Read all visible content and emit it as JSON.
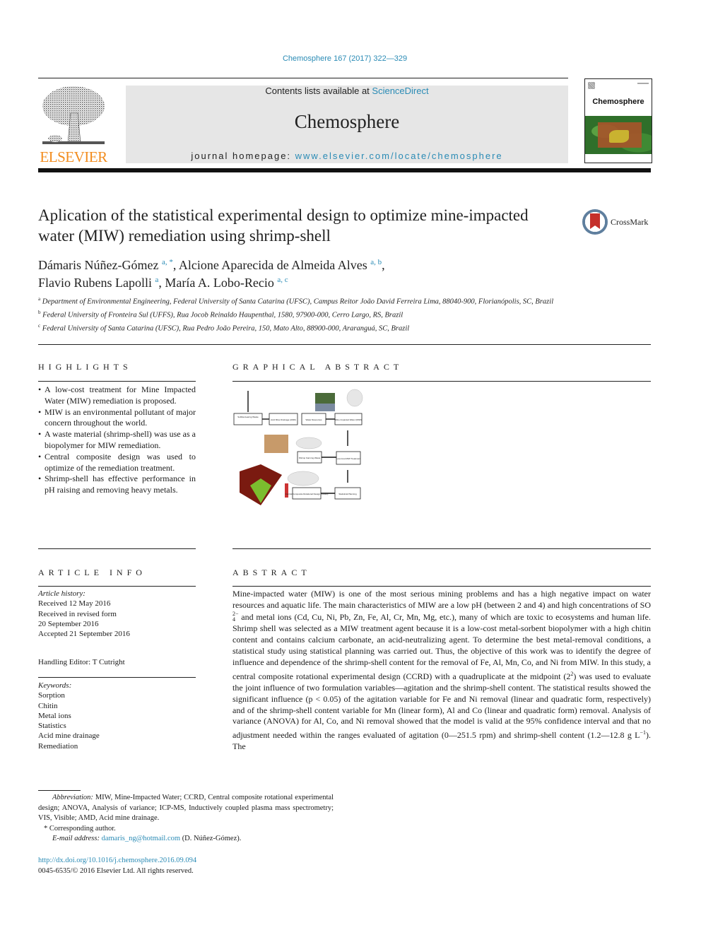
{
  "header": {
    "citation": "Chemosphere 167 (2017) 322—329",
    "contents_prefix": "Contents lists available at ",
    "contents_link": "ScienceDirect",
    "journal_name": "Chemosphere",
    "homepage_prefix": "journal homepage: ",
    "homepage_link": "www.elsevier.com/locate/chemosphere",
    "publisher_wordmark": "ELSEVIER",
    "cover_title": "Chemosphere",
    "crossmark_label": "CrossMark"
  },
  "article": {
    "title": "Aplication of the statistical experimental design to optimize mine-impacted water (MIW) remediation using shrimp-shell",
    "authors": [
      {
        "name": "Dámaris Núñez-Gómez",
        "sup": "a, *",
        "sep": ", "
      },
      {
        "name": "Alcione Aparecida de Almeida Alves",
        "sup": "a, b",
        "sep": ","
      },
      {
        "name": "Flavio Rubens Lapolli",
        "sup": "a",
        "sep": ", "
      },
      {
        "name": "María A. Lobo-Recio",
        "sup": "a, c",
        "sep": ""
      }
    ],
    "affiliations": [
      {
        "mark": "a",
        "text": "Department of Environmental Engineering, Federal University of Santa Catarina (UFSC), Campus Reitor João David Ferreira Lima, 88040-900, Florianópolis, SC, Brazil"
      },
      {
        "mark": "b",
        "text": "Federal University of Fronteira Sul (UFFS), Rua Jocob Reinaldo Haupenthal, 1580, 97900-000, Cerro Largo, RS, Brazil"
      },
      {
        "mark": "c",
        "text": "Federal University of Santa Catarina (UFSC), Rua Pedro João Pereira, 150, Mato Alto, 88900-000, Araranguá, SC, Brazil"
      }
    ]
  },
  "highlights": {
    "heading": "HIGHLIGHTS",
    "items": [
      "A low-cost treatment for Mine Impacted Water (MIW) remediation is proposed.",
      "MIW is an environmental pollutant of major concern throughout the world.",
      "A waste material (shrimp-shell) was use as a biopolymer for MIW remediation.",
      "Central composite design was used to optimize of the remediation treatment.",
      "Shrimp-shell has effective performance in pH raising and removing heavy metals."
    ]
  },
  "graphical_abstract": {
    "heading": "GRAPHICAL ABSTRACT",
    "boxes": {
      "sulfide_waste": "Sulfide-bearing Waste",
      "amd": "Acid Mine Drainage (AMD)",
      "water_resources": "Water Resources",
      "miw": "Mine Impacted Water (MIW)",
      "shrimp_waste": "Shrimp Farming Waste",
      "treatment": "Low-Cost MIW Treatment",
      "statistical": "Statistical Planning",
      "ccrd": "Central Composite Rotational Design (CCRD)"
    }
  },
  "article_info": {
    "heading": "ARTICLE INFO",
    "history_label": "Article history:",
    "history": [
      "Received 12 May 2016",
      "Received in revised form",
      "20 September 2016",
      "Accepted 21 September 2016"
    ],
    "handling_editor": "Handling Editor: T Cutright",
    "keywords_label": "Keywords:",
    "keywords": [
      "Sorption",
      "Chitin",
      "Metal ions",
      "Statistics",
      "Acid mine drainage",
      "Remediation"
    ]
  },
  "abstract": {
    "heading": "ABSTRACT",
    "p1": "Mine-impacted water (MIW) is one of the most serious mining problems and has a high negative impact on water resources and aquatic life. The main characteristics of MIW are a low pH (between 2 and 4) and high concentrations of SO",
    "so4_sup": "2−",
    "so4_sub": "4",
    "p2": " and metal ions (Cd, Cu, Ni, Pb, Zn, Fe, Al, Cr, Mn, Mg, etc.), many of which are toxic to ecosystems and human life. Shrimp shell was selected as a MIW treatment agent because it is a low-cost metal-sorbent biopolymer with a high chitin content and contains calcium carbonate, an acid-neutralizing agent. To determine the best metal-removal conditions, a statistical study using statistical planning was carried out. Thus, the objective of this work was to identify the degree of influence and dependence of the shrimp-shell content for the removal of Fe, Al, Mn, Co, and Ni from MIW. In this study, a central composite rotational experimental design (CCRD) with a quadruplicate at the midpoint (2",
    "p2_sup": "2",
    "p3": ") was used to evaluate the joint influence of two formulation variables—agitation and the shrimp-shell content. The statistical results showed the significant influence (p < 0.05) of the agitation variable for Fe and Ni removal (linear and quadratic form, respectively) and of the shrimp-shell content variable for Mn (linear form), Al and Co (linear and quadratic form) removal. Analysis of variance (ANOVA) for Al, Co, and Ni removal showed that the model is valid at the 95% confidence interval and that no adjustment needed within the ranges evaluated of agitation (0—251.5 rpm) and shrimp-shell content (1.2—12.8 g L",
    "p3_sup": "−1",
    "p4": "). The"
  },
  "footnotes": {
    "abbrev_label": "Abbreviation:",
    "abbrev_text": " MIW, Mine-Impacted Water; CCRD, Central composite rotational experimental design; ANOVA, Analysis of variance; ICP-MS, Inductively coupled plasma mass spectrometry; VIS, Visible; AMD, Acid mine drainage.",
    "corresponding": "* Corresponding author.",
    "email_label": "E-mail address:",
    "email": "damaris_ng@hotmail.com",
    "email_suffix": " (D. Núñez-Gómez).",
    "doi": "http://dx.doi.org/10.1016/j.chemosphere.2016.09.094",
    "copyright": "0045-6535/© 2016 Elsevier Ltd. All rights reserved."
  }
}
